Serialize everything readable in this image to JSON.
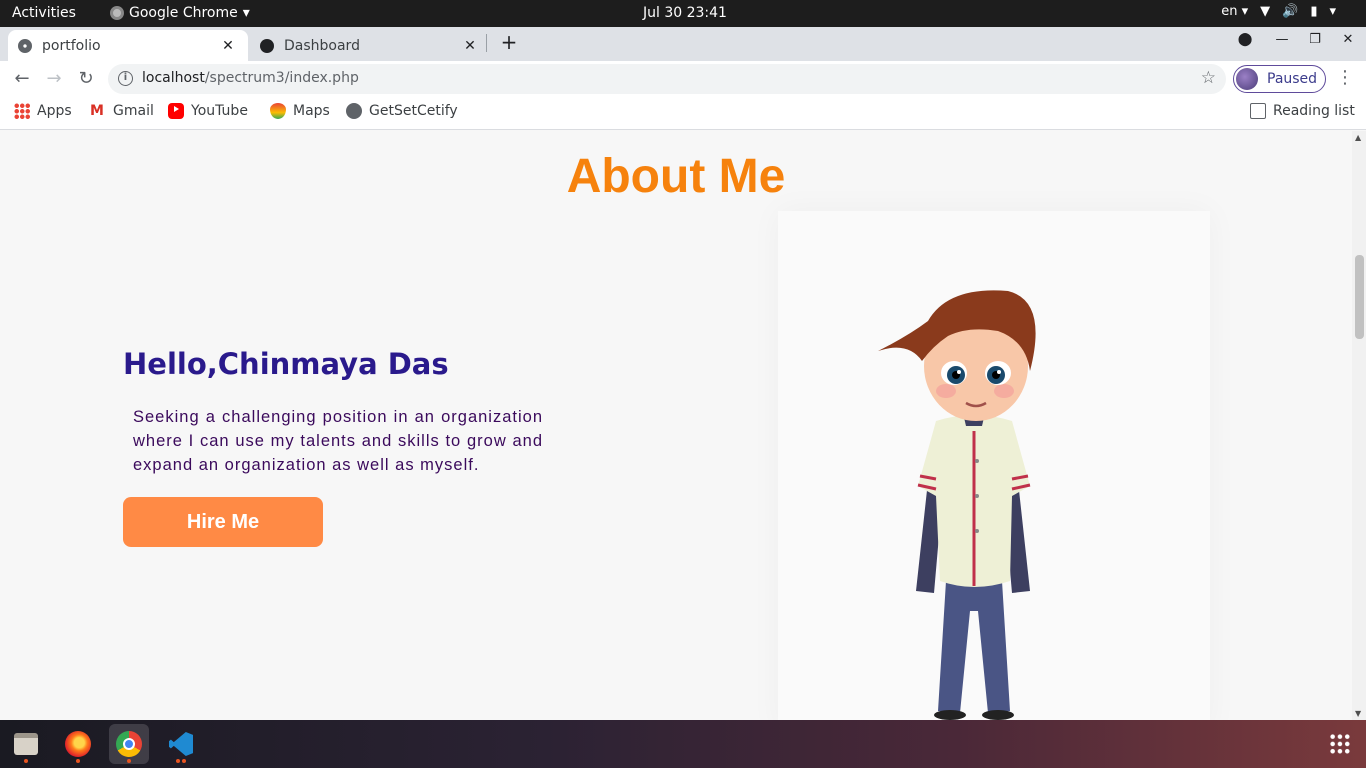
{
  "topbar": {
    "activities": "Activities",
    "app_name": "Google Chrome",
    "clock": "Jul 30  23:41",
    "lang": "en"
  },
  "tabs": [
    {
      "title": "portfolio",
      "active": true
    },
    {
      "title": "Dashboard",
      "active": false
    }
  ],
  "toolbar": {
    "url_host": "localhost",
    "url_path": "/spectrum3/index.php",
    "profile_label": "Paused"
  },
  "bookmarks": {
    "items": [
      {
        "label": "Apps",
        "icon": "apps-grid-icon"
      },
      {
        "label": "Gmail",
        "icon": "gmail-icon"
      },
      {
        "label": "YouTube",
        "icon": "youtube-icon"
      },
      {
        "label": "Maps",
        "icon": "maps-icon"
      },
      {
        "label": "GetSetCetify",
        "icon": "globe-icon"
      }
    ],
    "reading_list": "Reading list"
  },
  "page": {
    "title": "About Me",
    "greeting": "Hello,Chinmaya Das",
    "bio": "Seeking a challenging position in an organization where I can use my talents and skills to grow and expand an organization as well as myself.",
    "hire_button": "Hire Me",
    "accent_color": "#f6820d",
    "button_color": "#ff8a45"
  },
  "dock": {
    "apps": [
      "files-icon",
      "firefox-icon",
      "chrome-icon",
      "vscode-icon"
    ]
  }
}
